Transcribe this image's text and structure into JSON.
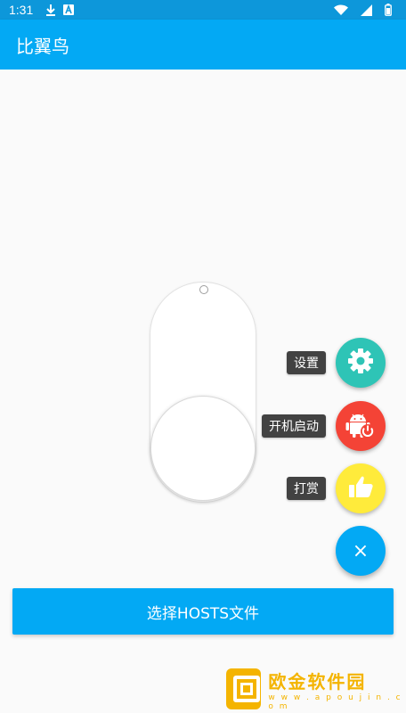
{
  "status_bar": {
    "time": "1:31",
    "icons": [
      "download-icon",
      "a-notification-icon",
      "wifi-icon",
      "signal-icon",
      "battery-icon"
    ]
  },
  "app_bar": {
    "title": "比翼鸟"
  },
  "fab_menu": {
    "items": [
      {
        "label": "设置",
        "icon": "gear-icon",
        "color": "#2ec4b6"
      },
      {
        "label": "开机启动",
        "icon": "android-power-icon",
        "color": "#f44336"
      },
      {
        "label": "打赏",
        "icon": "thumbs-up-icon",
        "color": "#ffeb3b"
      }
    ],
    "main_icon": "close-icon",
    "main_symbol": "×",
    "main_color": "#03a9f4"
  },
  "primary_button": {
    "label": "选择HOSTS文件"
  },
  "watermark": {
    "title": "欧金软件园",
    "url": "w w w . a p o u j i n . c o m"
  },
  "colors": {
    "primary": "#03a9f4",
    "status_bar": "#0d97da",
    "accent_gold": "#f4b400"
  }
}
